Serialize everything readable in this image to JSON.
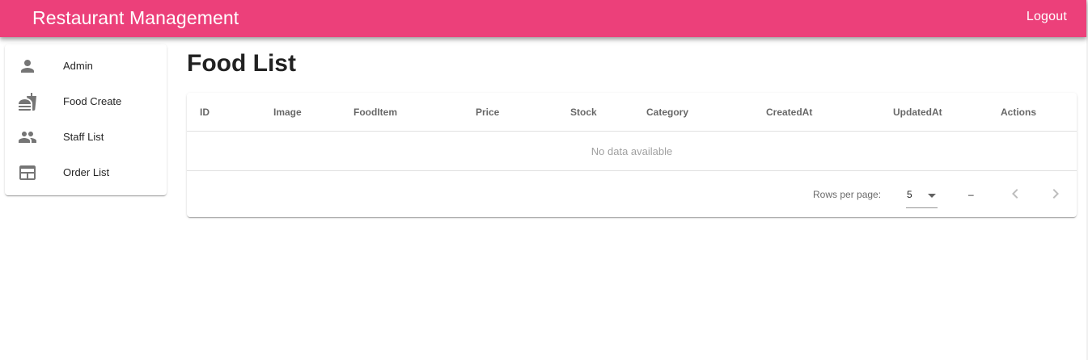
{
  "app": {
    "title": "Restaurant Management",
    "logout_label": "Logout",
    "accent_color": "#ec407a"
  },
  "sidebar": {
    "items": [
      {
        "label": "Admin",
        "icon": "person-icon"
      },
      {
        "label": "Food Create",
        "icon": "fastfood-icon"
      },
      {
        "label": "Staff List",
        "icon": "people-icon"
      },
      {
        "label": "Order List",
        "icon": "table-icon"
      }
    ]
  },
  "main": {
    "title": "Food List",
    "table": {
      "columns": [
        "ID",
        "Image",
        "FoodItem",
        "Price",
        "Stock",
        "Category",
        "CreatedAt",
        "UpdatedAt",
        "Actions"
      ],
      "rows": [],
      "empty_text": "No data available"
    },
    "pagination": {
      "rows_per_page_label": "Rows per page:",
      "rows_per_page_value": "5",
      "range_text": "–",
      "prev_icon": "chevron-left-icon",
      "next_icon": "chevron-right-icon"
    }
  }
}
